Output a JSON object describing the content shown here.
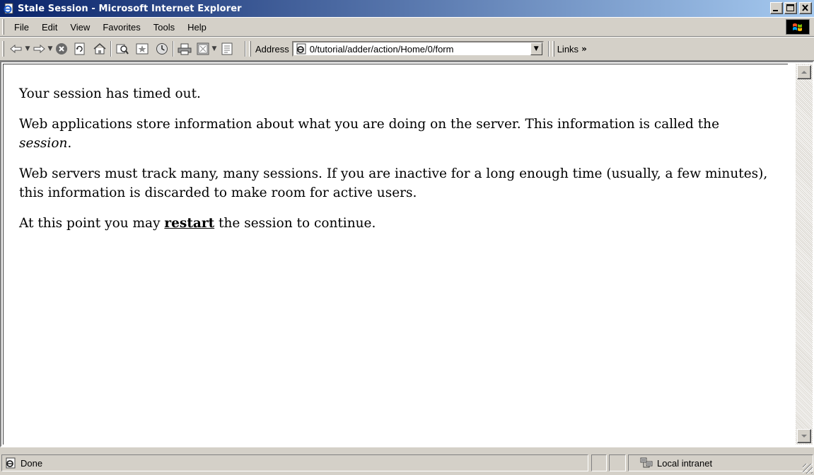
{
  "window": {
    "title": "Stale Session - Microsoft Internet Explorer"
  },
  "menu": {
    "items": [
      "File",
      "Edit",
      "View",
      "Favorites",
      "Tools",
      "Help"
    ]
  },
  "toolbar": {
    "address_label": "Address",
    "address_value": "0/tutorial/adder/action/Home/0/form",
    "links_label": "Links",
    "links_chevron": "»"
  },
  "page": {
    "p1": "Your session has timed out.",
    "p2_before": "Web applications store information about what you are doing on the server. This information is called the ",
    "p2_em": "session",
    "p2_after": ".",
    "p3": "Web servers must track many, many sessions. If you are inactive for a long enough time (usually, a few minutes), this information is discarded to make room for active users.",
    "p4_before": "At this point you may ",
    "p4_link": "restart",
    "p4_after": " the session to continue."
  },
  "status": {
    "text": "Done",
    "zone": "Local intranet"
  },
  "icons": {
    "title": "ie-page-icon",
    "back": "back-arrow-icon",
    "forward": "forward-arrow-icon",
    "stop": "stop-icon",
    "refresh": "refresh-icon",
    "home": "home-icon",
    "search": "search-icon",
    "favorites": "favorites-icon",
    "history": "history-icon",
    "print": "print-icon",
    "edit": "edit-icon",
    "discuss": "discuss-icon"
  }
}
